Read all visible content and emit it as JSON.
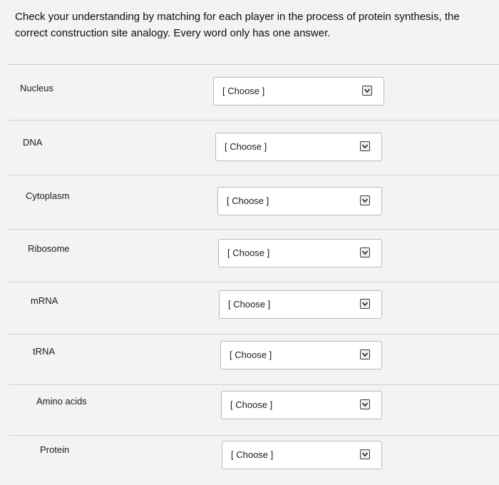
{
  "instructions": {
    "line1": "Check your understanding by matching for each player in the process of protein synthesis, the",
    "line2": "correct construction site analogy. Every word only has one answer."
  },
  "rows": [
    {
      "label": "Nucleus",
      "select": "[ Choose ]"
    },
    {
      "label": "DNA",
      "select": "[ Choose ]"
    },
    {
      "label": "Cytoplasm",
      "select": "[ Choose ]"
    },
    {
      "label": "Ribosome",
      "select": "[ Choose ]"
    },
    {
      "label": "mRNA",
      "select": "[ Choose ]"
    },
    {
      "label": "tRNA",
      "select": "[ Choose ]"
    },
    {
      "label": "Amino acids",
      "select": "[ Choose ]"
    },
    {
      "label": "Protein",
      "select": "[ Choose ]"
    }
  ],
  "icons": {
    "dropdown": "chevron-down-icon"
  }
}
